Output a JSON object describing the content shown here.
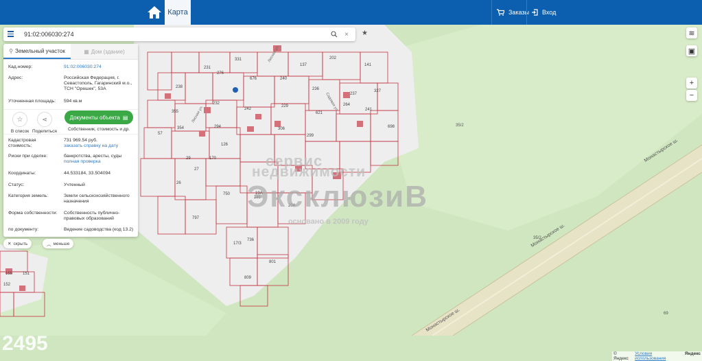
{
  "header": {
    "map_tab": "Карта",
    "orders": "Заказы",
    "login": "Вход"
  },
  "search": {
    "value": "91:02:006030:274"
  },
  "panel": {
    "tab_land": "Земельный участок",
    "tab_house": "Дом (здание)",
    "fields": [
      {
        "label": "Кад.номер:",
        "value": "91:02:006030:274"
      },
      {
        "label": "Адрес:",
        "value": "Российская Федерация, г. Севастополь, Гагаринский м.о., ТСН \"Орешек\", 53А"
      },
      {
        "label": "Уточненная площадь:",
        "value": "594 кв.м"
      }
    ],
    "actions": {
      "to_list": "В список",
      "share": "Поделиться",
      "documents": "Документы объекта",
      "documents_sub": "Собственник, стоимость и др."
    },
    "details": [
      {
        "label": "Кадастровая стоимость:",
        "value": "731 969.54 руб.",
        "link": "заказать справку на дату"
      },
      {
        "label": "Риски при сделке:",
        "value": "банкротства, аресты, суды",
        "link": "полная проверка"
      },
      {
        "label": "Координаты:",
        "value": "44.533184, 33.504094",
        "link": ""
      },
      {
        "label": "Статус:",
        "value": "Учтенный",
        "link": ""
      },
      {
        "label": "Категория земель:",
        "value": "Земли сельскохозяйственного назначения",
        "link": ""
      },
      {
        "label": "Форма собственности:",
        "value": "Собственность публично-правовых образований",
        "link": ""
      },
      {
        "label": "по документу:",
        "value": "Ведение садоводства (код 13.2)",
        "link": ""
      }
    ],
    "hide": "скрыть",
    "less": "меньше"
  },
  "map": {
    "road_labels": [
      "Монастырское ш.",
      "Монастырское ш.",
      "Монастырское ш."
    ],
    "parcel_labels": [
      "35/2",
      "35/2",
      "69"
    ],
    "watermark": {
      "line1": "сервис",
      "line2": "недвижимости",
      "line3": "ЭксклюзиВ",
      "line4": "основано в 2009 году"
    },
    "corner_number": "2495",
    "attribution": [
      "© Яндекс",
      "Условия использования",
      "Яндекс"
    ]
  },
  "colors": {
    "header": "#0b5fae",
    "map_green": "#cfe6c0",
    "parcel_border": "#c0353f",
    "button_green": "#39a845",
    "link": "#2e7bc7"
  }
}
